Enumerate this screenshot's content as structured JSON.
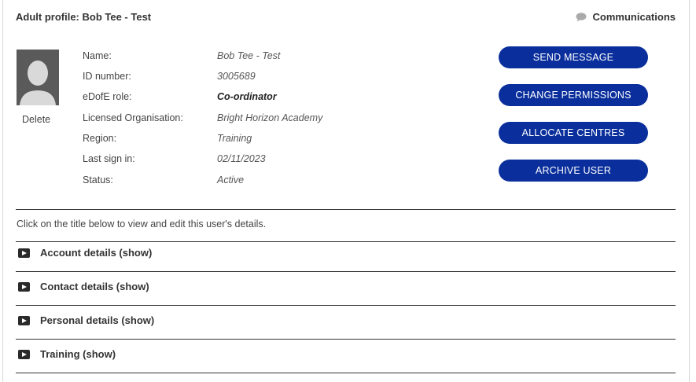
{
  "header": {
    "title": "Adult profile: Bob Tee - Test",
    "communications_label": "Communications",
    "communications_icon": "speech-bubble-icon"
  },
  "profile": {
    "avatar_icon": "user-silhouette-icon",
    "delete_label": "Delete",
    "fields": [
      {
        "label": "Name:",
        "value": "Bob Tee - Test"
      },
      {
        "label": "ID number:",
        "value": "3005689"
      },
      {
        "label": "eDofE role:",
        "value": "Co-ordinator"
      },
      {
        "label": "Licensed Organisation:",
        "value": "Bright Horizon Academy"
      },
      {
        "label": "Region:",
        "value": "Training"
      },
      {
        "label": "Last sign in:",
        "value": "02/11/2023"
      },
      {
        "label": "Status:",
        "value": "Active"
      }
    ]
  },
  "actions": {
    "send_message": "SEND MESSAGE",
    "change_permissions": "CHANGE PERMISSIONS",
    "allocate_centres": "ALLOCATE CENTRES",
    "archive_user": "ARCHIVE USER",
    "button_color": "#0a2f9c"
  },
  "instructions": "Click on the title below to view and edit this user's details.",
  "sections": [
    {
      "title": "Account details (show)",
      "icon": "play-icon"
    },
    {
      "title": "Contact details (show)",
      "icon": "play-icon"
    },
    {
      "title": "Personal details (show)",
      "icon": "play-icon"
    },
    {
      "title": "Training (show)",
      "icon": "play-icon"
    }
  ]
}
